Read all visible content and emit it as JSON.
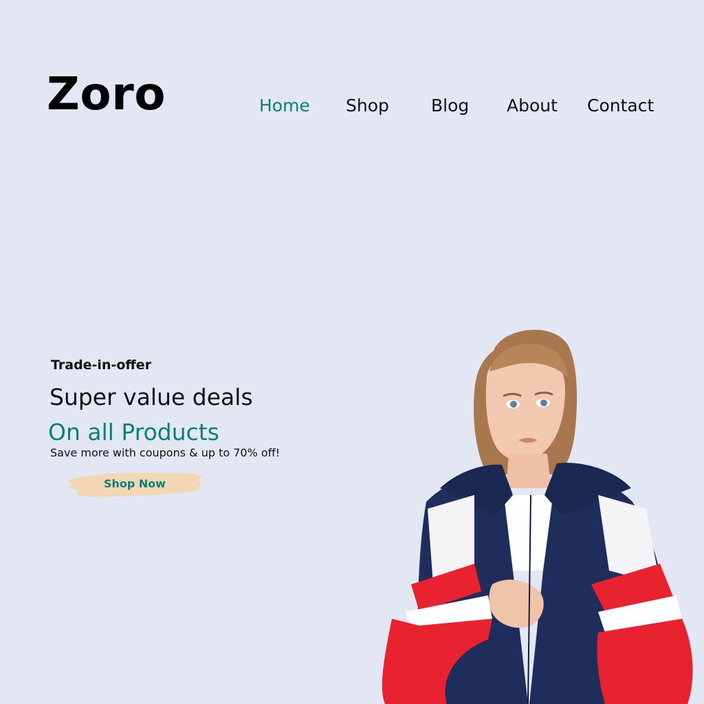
{
  "header": {
    "logo": "Zoro",
    "nav": {
      "home": "Home",
      "shop": "Shop",
      "blog": "Blog",
      "about": "About",
      "contact": "Contact"
    }
  },
  "hero": {
    "eyebrow": "Trade-in-offer",
    "title": "Super value deals",
    "subtitle": "On all Products",
    "description": "Save more with coupons & up to 70% off!",
    "button_label": "Shop Now"
  },
  "colors": {
    "background": "#e3e6f3",
    "accent": "#088178",
    "button_brush": "#f3d7b5"
  }
}
